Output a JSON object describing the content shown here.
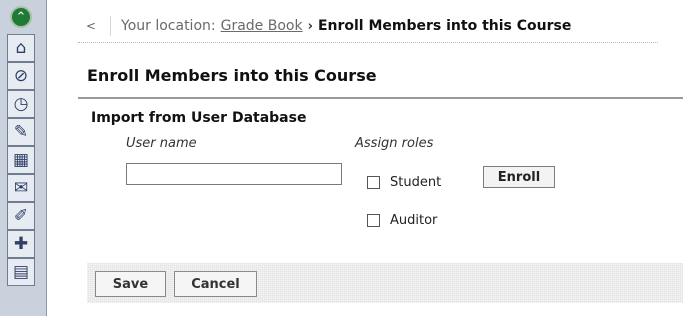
{
  "toolbar": {
    "icons": [
      "collapse-icon",
      "home-icon",
      "satellite-icon",
      "clock-document-icon",
      "edit-document-icon",
      "calendar-icon",
      "chat-bubble-icon",
      "pin-icon",
      "add-member-icon",
      "page-icon"
    ]
  },
  "breadcrumb": {
    "back_label": "<",
    "location_label": "Your location:",
    "link_label": "Grade Book",
    "arrow": "›",
    "current": "Enroll Members into this Course"
  },
  "page": {
    "title": "Enroll Members into this Course"
  },
  "section": {
    "title": "Import from User Database",
    "username_label": "User name",
    "roles_label": "Assign roles",
    "username_value": "",
    "roles": [
      {
        "label": "Student",
        "checked": false
      },
      {
        "label": "Auditor",
        "checked": false
      }
    ],
    "enroll_label": "Enroll"
  },
  "actions": {
    "save_label": "Save",
    "cancel_label": "Cancel"
  },
  "colors": {
    "sidebar_bg": "#c9d1dd",
    "accent_green": "#1f7a36"
  }
}
